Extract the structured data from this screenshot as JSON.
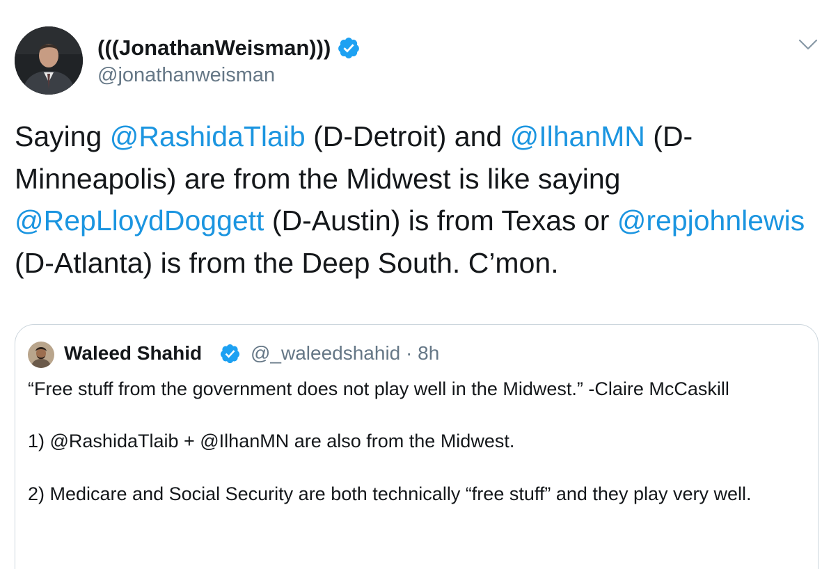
{
  "author": {
    "display_name": "(((JonathanWeisman)))",
    "handle": "@jonathanweisman",
    "verified_icon": "verified-badge-icon"
  },
  "menu": {
    "icon": "chevron-down-icon"
  },
  "tweet": {
    "t1": "Saying ",
    "m1": "@RashidaTlaib",
    "t2": " (D-Detroit) and ",
    "m2": "@IlhanMN",
    "t3": " (D-Minneapolis) are from the Midwest is like saying ",
    "m3": "@RepLloydDoggett",
    "t4": " (D-Austin) is from Texas or ",
    "m4": "@repjohnlewis",
    "t5": " (D-Atlanta) is from the Deep South. C’mon."
  },
  "quote": {
    "display_name": "Waleed Shahid",
    "handle": "@_waleedshahid",
    "separator": " · ",
    "time": "8h",
    "line1": "“Free stuff from the government does not play well in the Midwest.” -Claire McCaskill",
    "line2": "1) @RashidaTlaib + @IlhanMN are also from the Midwest.",
    "line3": "2) Medicare and Social Security are both technically “free stuff” and they play very well."
  },
  "colors": {
    "link": "#1b95e0",
    "verified": "#1da1f2",
    "text": "#14171a",
    "secondary": "#657786",
    "border": "#ccd6dd"
  }
}
